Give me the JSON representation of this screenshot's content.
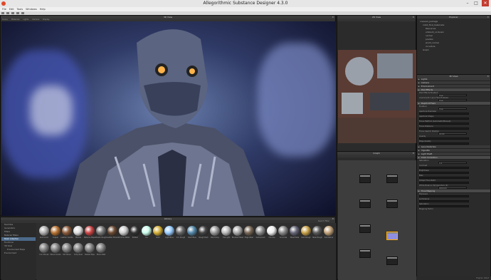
{
  "window": {
    "title": "Allegorithmic Substance Designer 4.3.0",
    "minimize": "–",
    "maximize": "□",
    "close": "✕"
  },
  "menu": [
    "File",
    "Edit",
    "Tools",
    "Windows",
    "Help"
  ],
  "view3d": {
    "title": "3D View",
    "toolbar": [
      "Scene",
      "Materials",
      "Lights",
      "Camera",
      "Display"
    ]
  },
  "view2d": {
    "title": "2D View",
    "footer": "(1/4) 2048x2048 - RGBA"
  },
  "graph": {
    "title": "Graph"
  },
  "explorer": {
    "title": "Explorer",
    "items": [
      "unsaved_package",
      "robot_final_baked.sbs",
      "Resources",
      "ambient_occlusion",
      "normal",
      "position",
      "world_normal",
      "curvature",
      "Graph"
    ]
  },
  "props": {
    "title": "3D View",
    "sections": [
      "Lights",
      "Camera",
      "Environment",
      "Post Effects"
    ],
    "post_label": "Post Effects Enabled",
    "post_val": "True",
    "dist_label": "Anamorphic Lens Flare Enabled",
    "dist_val": "True",
    "dof": "Depth Of Field",
    "rows": [
      "Enabled",
      "Aperture Diameter",
      "Aperture Shape",
      "Focus Method (Automatic/Manual)",
      "Focus Distance",
      "Focus Search Position",
      "Quality",
      "Edge Quality"
    ],
    "enabled_val": "True",
    "focus_val": "10.00",
    "lower_sections": [
      "Lens Distortion",
      "Vignette",
      "Light Shaft",
      "Color Correction"
    ],
    "cc_rows": [
      "Saturation",
      "Contrast",
      "Brightness",
      "Bias",
      "Output Tone Ratio",
      "White Balance Temperature (K)"
    ],
    "sat_val": "1.0",
    "wb_val": "6500.00",
    "tone": "Tone Mapping",
    "tone_rows": [
      "Exposure",
      "Luminance",
      "Saturation",
      "Mapping Factor"
    ]
  },
  "library": {
    "title": "Library",
    "search_placeholder": "Search Filter",
    "categories": [
      "Favorites",
      "Generators",
      "Filters",
      "Material Filters",
      "Mesh Adaptive",
      "Functions",
      "3D View",
      "Environment Maps",
      "Environment"
    ],
    "row1": [
      "Aluminium",
      "Copper",
      "Leather Saddle",
      "Marble",
      "Material Maps",
      "Plastic Rough",
      "Leather Brown",
      "Chrome Metal",
      "Rubber",
      "Ice",
      "Gold",
      "Light Blue",
      "Iron Rough",
      "Paint Blue",
      "Rough Dark",
      "Paint Grey",
      "Tile Light",
      "Brushed Steel",
      "Edge Wear",
      "Galvanized",
      "Chrome",
      "Concrete",
      "Steel Plate",
      "Gold Rough",
      "Steel Rough",
      "Sandstone"
    ],
    "row2": [
      "Iron Stones",
      "Stone Cracks",
      "Old Stone",
      "Dirty Rust",
      "Rusted Pipe",
      "Stone Wall"
    ]
  },
  "status": "Engine: OGL3"
}
